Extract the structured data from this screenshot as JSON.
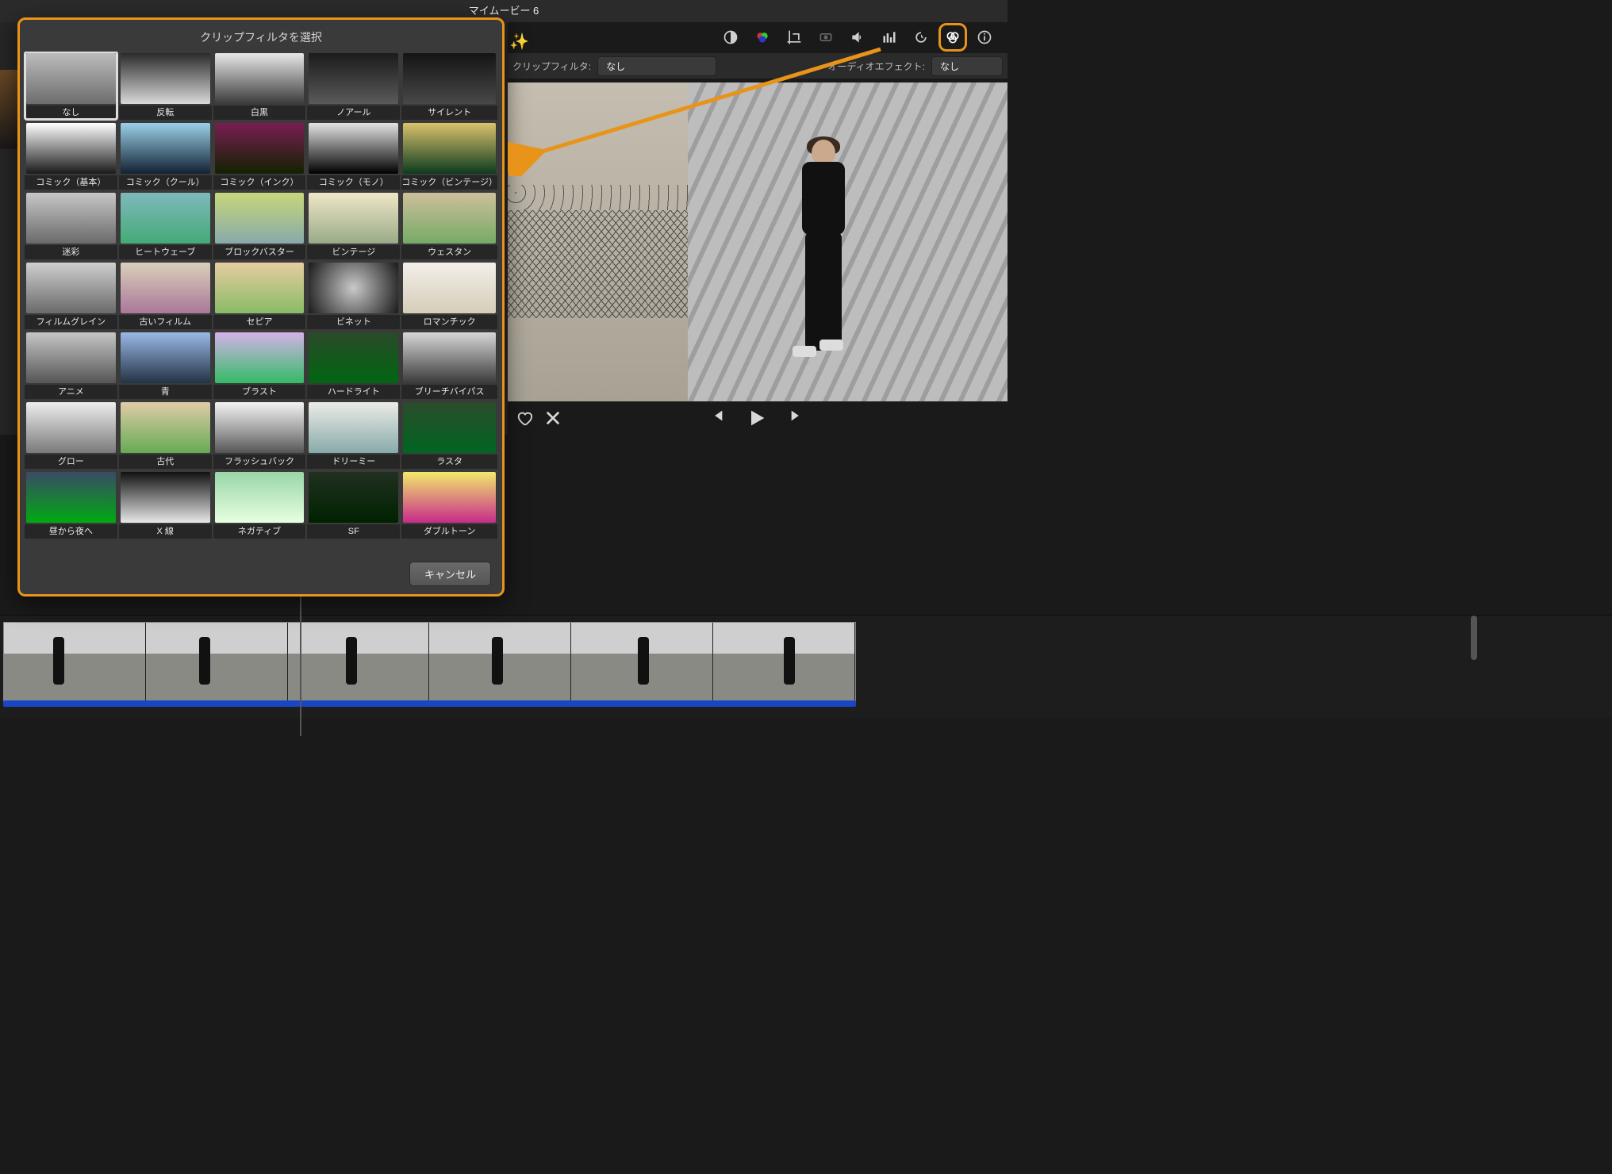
{
  "title": "マイムービー 6",
  "inspector": {
    "clip_filter_label": "クリップフィルタ:",
    "clip_filter_value": "なし",
    "audio_effect_label": "オーディオエフェクト:",
    "audio_effect_value": "なし"
  },
  "popover": {
    "title": "クリップフィルタを選択",
    "cancel": "キャンセル",
    "filters": [
      {
        "label": "なし",
        "sel": true,
        "css": "linear-gradient(#bcbcbc,#6d6d6d)"
      },
      {
        "label": "反転",
        "css": "linear-gradient(#2b2b2b,#d9d9d9)"
      },
      {
        "label": "白黒",
        "css": "linear-gradient(#e8e8e8,#3a3a3a)"
      },
      {
        "label": "ノアール",
        "css": "linear-gradient(#1b1b1b,#5a5a5a)"
      },
      {
        "label": "サイレント",
        "css": "linear-gradient(#141414,#484848)"
      },
      {
        "label": "コミック（基本）",
        "css": "linear-gradient(#ffffff,#1a1a1a)"
      },
      {
        "label": "コミック（クール）",
        "css": "linear-gradient(#9bd0e8,#123)"
      },
      {
        "label": "コミック（インク）",
        "css": "linear-gradient(#7a1e52,#120)"
      },
      {
        "label": "コミック（モノ）",
        "css": "linear-gradient(#e4e4e4,#000)"
      },
      {
        "label": "コミック（ビンテージ）",
        "css": "linear-gradient(#d9c26c,#0d3b1e)"
      },
      {
        "label": "迷彩",
        "css": "linear-gradient(#c7c7c7,#6a6a6a)"
      },
      {
        "label": "ヒートウェーブ",
        "css": "linear-gradient(#7fb9bb,#4a7)"
      },
      {
        "label": "ブロックバスター",
        "css": "linear-gradient(#c7d67a,#8aa)"
      },
      {
        "label": "ビンテージ",
        "css": "linear-gradient(#efe7c7,#9a8)"
      },
      {
        "label": "ウェスタン",
        "css": "linear-gradient(#cdbf9b,#7a6)"
      },
      {
        "label": "フィルムグレイン",
        "css": "linear-gradient(#cfcfcf,#6a6a6a)"
      },
      {
        "label": "古いフィルム",
        "css": "linear-gradient(#d9d0bb,#a79)"
      },
      {
        "label": "セピア",
        "css": "linear-gradient(#e6cda0,#8b6)"
      },
      {
        "label": "ビネット",
        "css": "radial-gradient(circle,#c9c9c9,#1a1a1a)"
      },
      {
        "label": "ロマンチック",
        "css": "linear-gradient(#f3efe9,#d6cdb9)"
      },
      {
        "label": "アニメ",
        "css": "linear-gradient(#c6c6c6,#555)"
      },
      {
        "label": "青",
        "css": "linear-gradient(#9bb8e6,#234)"
      },
      {
        "label": "ブラスト",
        "css": "linear-gradient(#d4b2e8,#3b6)"
      },
      {
        "label": "ハードライト",
        "css": "linear-gradient(#2a4a2a,#061)"
      },
      {
        "label": "ブリーチバイパス",
        "css": "linear-gradient(#d7d7d7,#3a3a3a)"
      },
      {
        "label": "グロー",
        "css": "linear-gradient(#eeeeee,#7a7a7a)"
      },
      {
        "label": "古代",
        "css": "linear-gradient(#e0cca6,#6a5)"
      },
      {
        "label": "フラッシュバック",
        "css": "linear-gradient(#f3f3f3,#999 60%,#555)"
      },
      {
        "label": "ドリーミー",
        "css": "linear-gradient(#ecece6,#8aa)"
      },
      {
        "label": "ラスタ",
        "css": "linear-gradient(#2b4c2b,#062)"
      },
      {
        "label": "昼から夜へ",
        "css": "linear-gradient(#3a4a66,#0a1)"
      },
      {
        "label": "X 線",
        "css": "linear-gradient(#111,#e8e8e8)"
      },
      {
        "label": "ネガティブ",
        "css": "linear-gradient(#98d6a8,#e7ffe0)"
      },
      {
        "label": "SF",
        "css": "linear-gradient(#203020,#020)"
      },
      {
        "label": "ダブルトーン",
        "css": "linear-gradient(#f2e96b,#c72b8a)"
      }
    ]
  },
  "timeline_frames": 6
}
